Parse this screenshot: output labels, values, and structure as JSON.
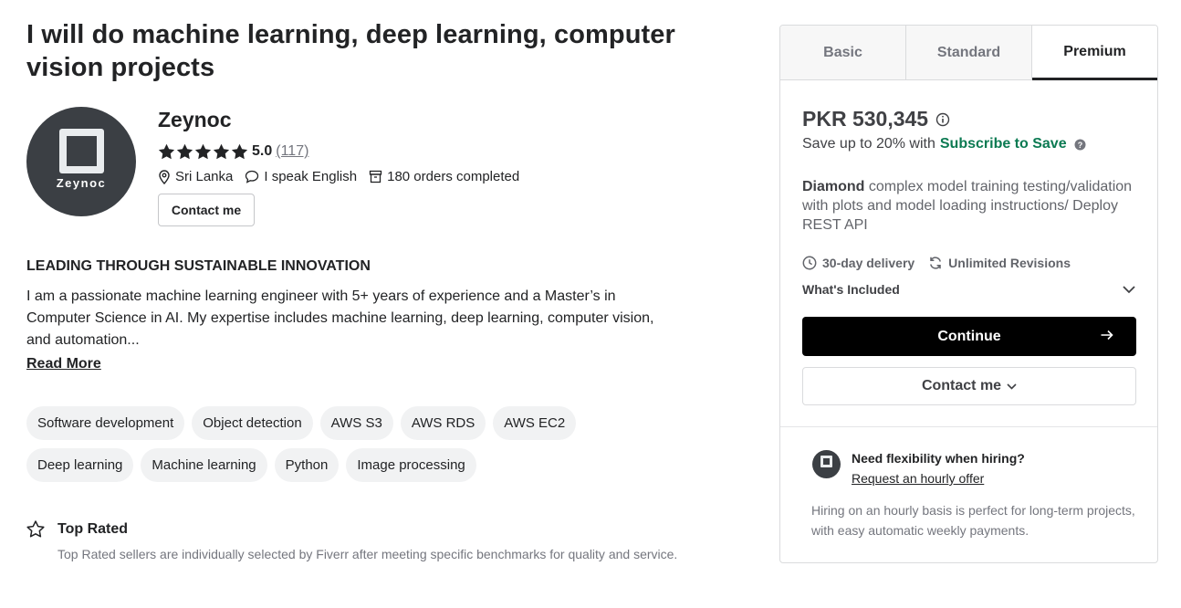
{
  "gig": {
    "title": "I will do machine learning, deep learning, computer vision projects"
  },
  "seller": {
    "avatar_text": "Zeynoc",
    "name": "Zeynoc",
    "rating_score": "5.0",
    "rating_count": "(117)",
    "stars": 5,
    "location": "Sri Lanka",
    "language": "I speak English",
    "orders": "180 orders completed",
    "contact_label": "Contact me"
  },
  "about": {
    "heading": "LEADING THROUGH SUSTAINABLE INNOVATION",
    "text": "I am a passionate machine learning engineer with 5+ years of experience and a Master’s in Computer Science in AI. My expertise includes machine learning, deep learning, computer vision, and automation...",
    "read_more": "Read More"
  },
  "tags": [
    "Software development",
    "Object detection",
    "AWS S3",
    "AWS RDS",
    "AWS EC2",
    "Deep learning",
    "Machine learning",
    "Python",
    "Image processing"
  ],
  "top_rated": {
    "title": "Top Rated",
    "description": "Top Rated sellers are individually selected by Fiverr after meeting specific benchmarks for quality and service."
  },
  "package_panel": {
    "tabs": [
      {
        "label": "Basic",
        "active": false
      },
      {
        "label": "Standard",
        "active": false
      },
      {
        "label": "Premium",
        "active": true
      }
    ],
    "price": "PKR 530,345",
    "save_prefix": "Save up to 20% with",
    "save_link": "Subscribe to Save",
    "description_bold": "Diamond",
    "description_rest": " complex model training testing/validation with plots and model loading instructions/ Deploy REST API",
    "delivery": "30-day delivery",
    "revisions": "Unlimited Revisions",
    "whats_included": "What's Included",
    "continue_label": "Continue",
    "contact_label": "Contact me",
    "hourly_title": "Need flexibility when hiring?",
    "hourly_link": "Request an hourly offer",
    "hourly_desc": "Hiring on an hourly basis is perfect for long-term projects, with easy automatic weekly payments."
  },
  "colors": {
    "accent_green": "#0b7a52",
    "primary_button": "#000000",
    "avatar_bg": "#3b3f44"
  }
}
